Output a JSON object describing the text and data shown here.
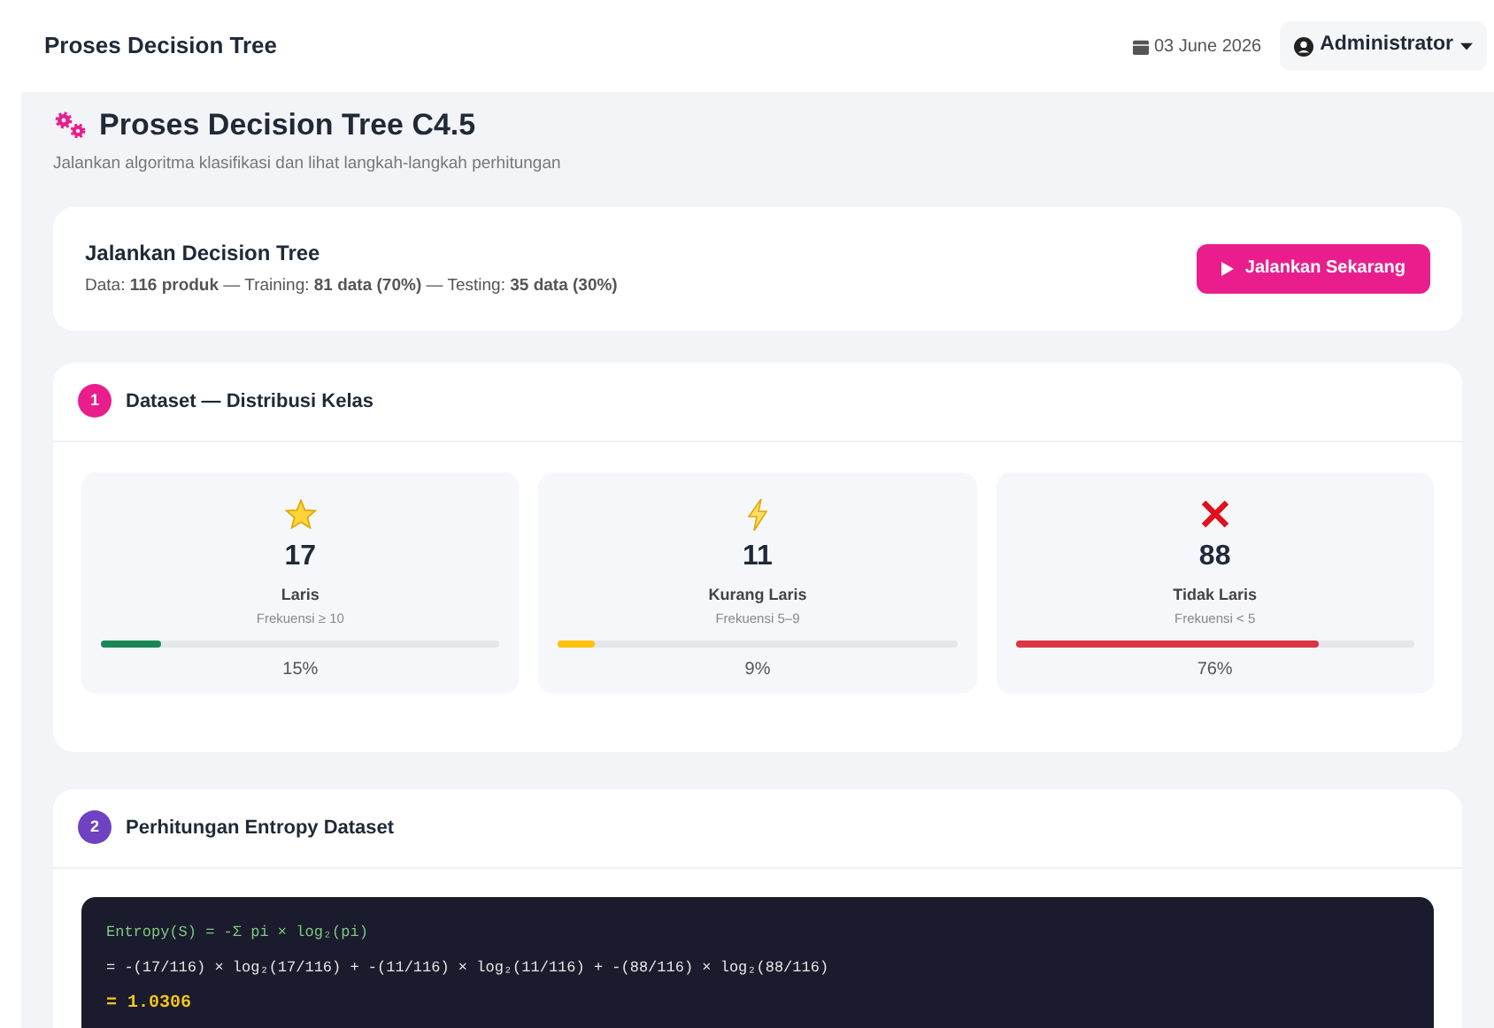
{
  "topbar": {
    "title": "Proses Decision Tree",
    "date": "03 June 2026",
    "user": "Administrator"
  },
  "header": {
    "title": "Proses Decision Tree C4.5",
    "subtitle": "Jalankan algoritma klasifikasi dan lihat langkah-langkah perhitungan"
  },
  "run_card": {
    "title": "Jalankan Decision Tree",
    "summary": "Data: **116 produk** — Training: **81 data (70%)** — Testing: **35 data (30%)**",
    "button": "Jalankan Sekarang"
  },
  "sections": [
    {
      "number": "1",
      "title": "Dataset — Distribusi Kelas",
      "color": "#e91e8c"
    },
    {
      "number": "2",
      "title": "Perhitungan Entropy Dataset",
      "color": "#6f42c1"
    }
  ],
  "classes": [
    {
      "kind": "best",
      "count": "17",
      "label": "Laris",
      "rule": "Frekuensi ≥ 10",
      "level": 0.15,
      "percent": "15%",
      "color": "#198754"
    },
    {
      "kind": "mid",
      "count": "11",
      "label": "Kurang Laris",
      "rule": "Frekuensi 5–9",
      "level": 0.09,
      "percent": "9%",
      "color": "#ffc107"
    },
    {
      "kind": "worst",
      "count": "88",
      "label": "Tidak Laris",
      "rule": "Frekuensi < 5",
      "level": 0.76,
      "percent": "76%",
      "color": "#dc3545"
    }
  ],
  "entropy_lines": [
    {
      "kind": "formula",
      "text": "Entropy(S) = -Σ pi × log₂(pi)"
    },
    {
      "kind": "expansion",
      "text": "= -(17/116) × log₂(17/116) + -(11/116) × log₂(11/116) + -(88/116) × log₂(88/116)"
    },
    {
      "kind": "result",
      "text": "= 1.0306"
    }
  ]
}
